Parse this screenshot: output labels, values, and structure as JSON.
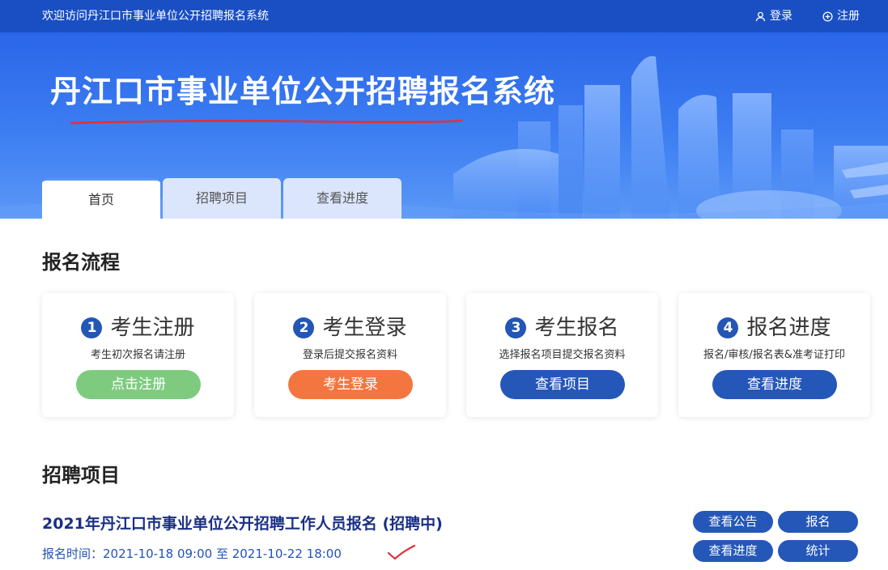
{
  "topbar": {
    "welcome": "欢迎访问丹江口市事业单位公开招聘报名系统",
    "login": "登录",
    "register": "注册"
  },
  "banner": {
    "title": "丹江口市事业单位公开招聘报名系统"
  },
  "tabs": [
    {
      "label": "首页",
      "active": true
    },
    {
      "label": "招聘项目",
      "active": false
    },
    {
      "label": "查看进度",
      "active": false
    }
  ],
  "process": {
    "title": "报名流程",
    "steps": [
      {
        "num": "1",
        "name": "考生注册",
        "desc": "考生初次报名请注册",
        "button": "点击注册",
        "color": "#7ecb7f"
      },
      {
        "num": "2",
        "name": "考生登录",
        "desc": "登录后提交报名资料",
        "button": "考生登录",
        "color": "#f37640"
      },
      {
        "num": "3",
        "name": "考生报名",
        "desc": "选择报名项目提交报名资料",
        "button": "查看项目",
        "color": "#2457b8"
      },
      {
        "num": "4",
        "name": "报名进度",
        "desc": "报名/审核/报名表&准考证打印",
        "button": "查看进度",
        "color": "#2457b8"
      }
    ]
  },
  "projects": {
    "title": "招聘项目",
    "items": [
      {
        "title": "2021年丹江口市事业单位公开招聘工作人员报名 (招聘中)",
        "time_label": "报名时间：",
        "time_range": "2021-10-18 09:00 至 2021-10-22 18:00",
        "buttons": {
          "notice": "查看公告",
          "apply": "报名",
          "progress": "查看进度",
          "stats": "统计"
        }
      }
    ]
  },
  "colors": {
    "topbar": "#1a4fc4",
    "primary": "#2457b8",
    "tab_inactive": "#dbe6fd",
    "project_title": "#1a2f86"
  }
}
